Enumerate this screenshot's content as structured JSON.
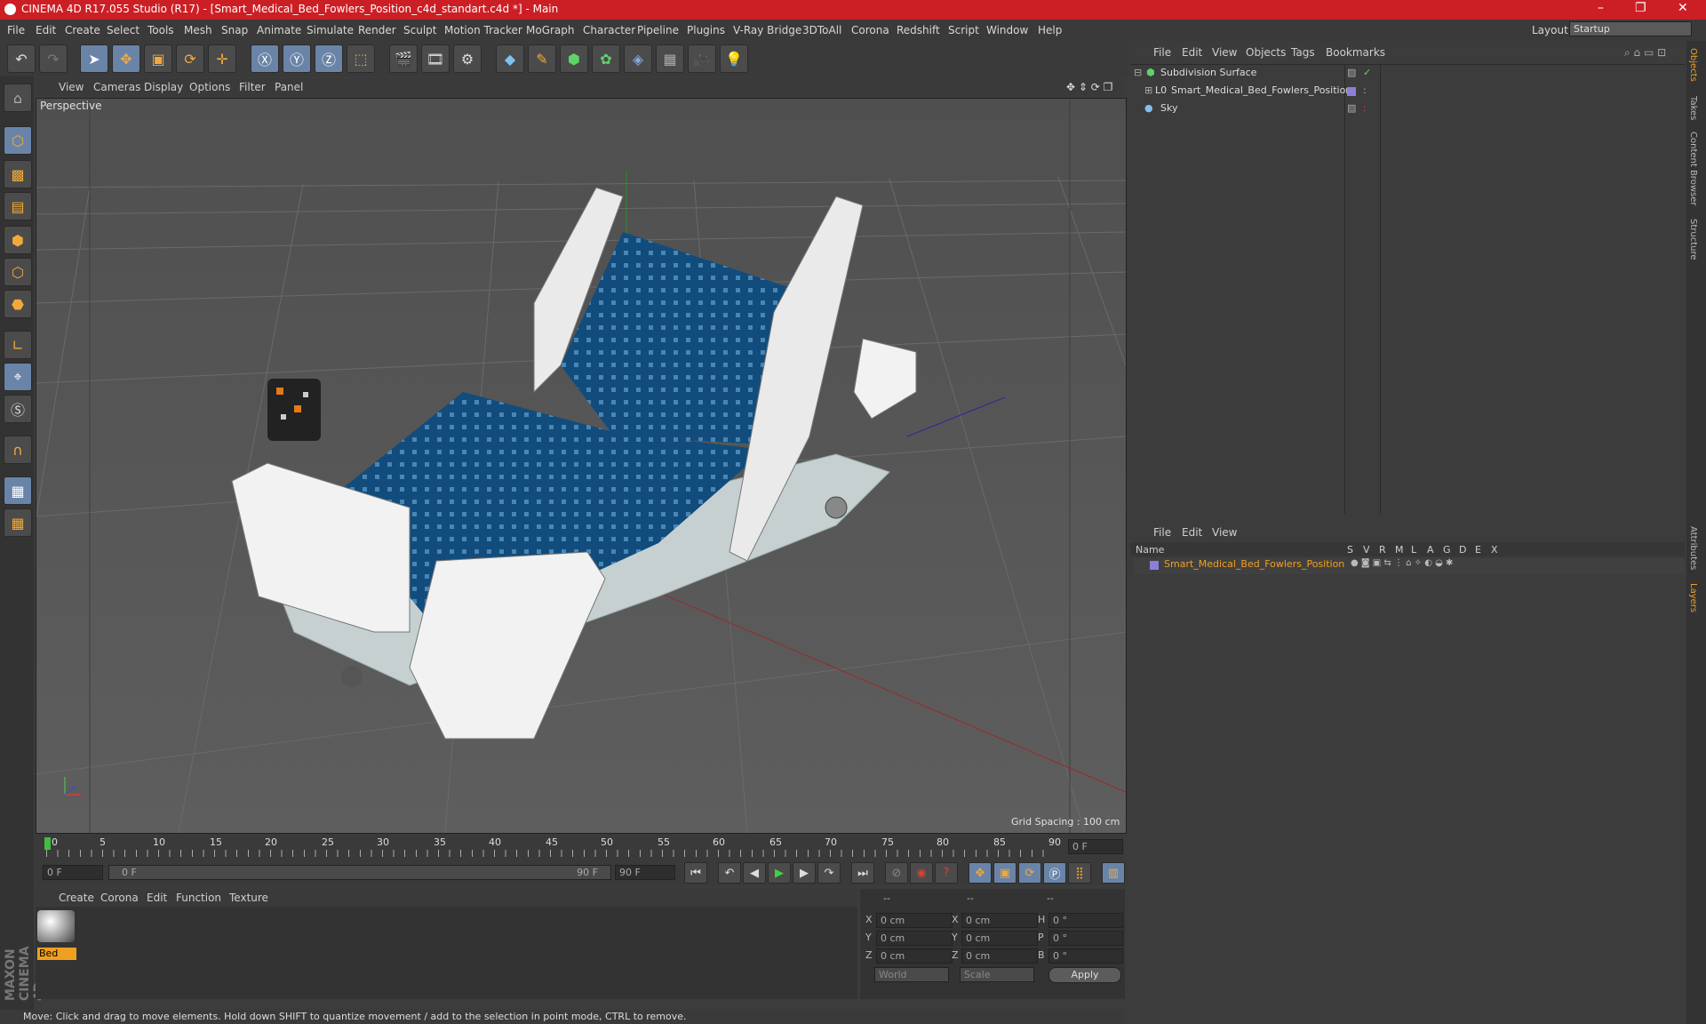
{
  "window": {
    "title": "CINEMA 4D R17.055 Studio (R17) - [Smart_Medical_Bed_Fowlers_Position_c4d_standart.c4d *] - Main",
    "controls": [
      "–",
      "❐",
      "✕"
    ]
  },
  "menubar": {
    "items": [
      "File",
      "Edit",
      "Create",
      "Select",
      "Tools",
      "Mesh",
      "Snap",
      "Animate",
      "Simulate",
      "Render",
      "Sculpt",
      "Motion Tracker",
      "MoGraph",
      "Character",
      "Pipeline",
      "Plugins",
      "V-Ray Bridge",
      "3DToAll",
      "Corona",
      "Redshift",
      "Script",
      "Window",
      "Help"
    ],
    "layout_label": "Layout:",
    "layout_value": "Startup"
  },
  "viewport": {
    "menu": [
      "View",
      "Cameras",
      "Display",
      "Options",
      "Filter",
      "Panel"
    ],
    "camera": "Perspective",
    "grid_spacing": "Grid Spacing : 100 cm"
  },
  "timeline": {
    "ticks": [
      "0",
      "5",
      "10",
      "15",
      "20",
      "25",
      "30",
      "35",
      "40",
      "45",
      "50",
      "55",
      "60",
      "65",
      "70",
      "75",
      "80",
      "85",
      "90"
    ],
    "current_frame": "0 F",
    "start_field": "0 F",
    "range_start": "0 F",
    "range_end": "90 F",
    "end_field": "90 F"
  },
  "materials": {
    "menu": [
      "Create",
      "Corona",
      "Edit",
      "Function",
      "Texture"
    ],
    "items": [
      {
        "name": "Bed"
      }
    ]
  },
  "coordinates": {
    "header": [
      "--",
      "--",
      "--"
    ],
    "rows": [
      {
        "a": "X",
        "av": "0 cm",
        "b": "X",
        "bv": "0 cm",
        "c": "H",
        "cv": "0 °"
      },
      {
        "a": "Y",
        "av": "0 cm",
        "b": "Y",
        "bv": "0 cm",
        "c": "P",
        "cv": "0 °"
      },
      {
        "a": "Z",
        "av": "0 cm",
        "b": "Z",
        "bv": "0 cm",
        "c": "B",
        "cv": "0 °"
      }
    ],
    "mode": "World",
    "scale": "Scale",
    "apply": "Apply"
  },
  "objects": {
    "menu": [
      "File",
      "Edit",
      "View",
      "Objects",
      "Tags",
      "Bookmarks"
    ],
    "items": [
      "Subdivision Surface",
      "Smart_Medical_Bed_Fowlers_Position",
      "Sky"
    ]
  },
  "layers": {
    "menu": [
      "File",
      "Edit",
      "View"
    ],
    "columns": [
      "Name",
      "S",
      "V",
      "R",
      "M",
      "L",
      "A",
      "G",
      "D",
      "E",
      "X"
    ],
    "items": [
      "Smart_Medical_Bed_Fowlers_Position"
    ],
    "accent": "#f0a020"
  },
  "side_tabs": [
    "Objects",
    "Takes",
    "Content Browser",
    "Structure",
    "Attributes",
    "Layers"
  ],
  "status": "Move: Click and drag to move elements. Hold down SHIFT to quantize movement / add to the selection in point mode, CTRL to remove.",
  "brand": "MAXON CINEMA 4D"
}
